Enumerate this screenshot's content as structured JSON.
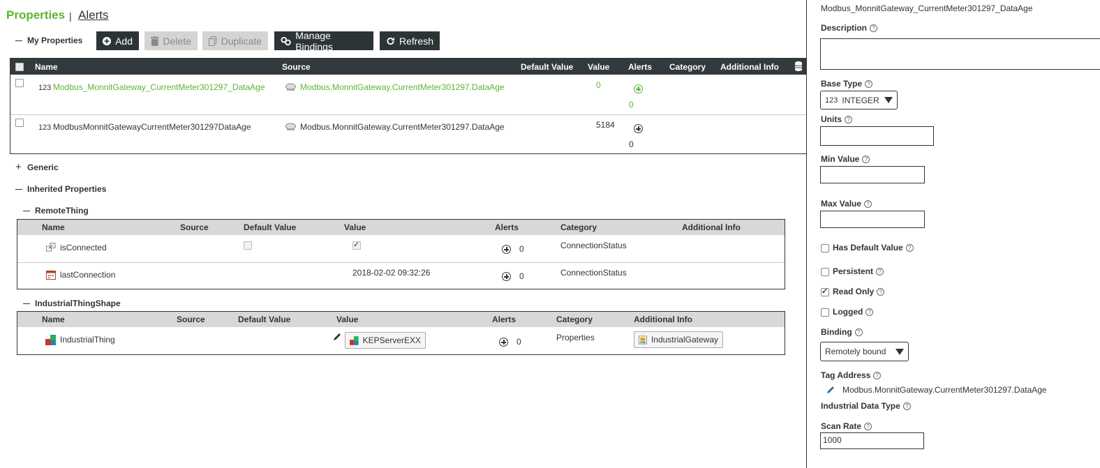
{
  "header": {
    "title": "Properties",
    "separator": "|",
    "alerts_link": "Alerts"
  },
  "my_properties": {
    "label": "My Properties",
    "toolbar": {
      "add": "Add",
      "delete": "Delete",
      "duplicate": "Duplicate",
      "manage_bindings": "Manage Bindings",
      "refresh": "Refresh"
    },
    "columns": [
      "Name",
      "Source",
      "Default Value",
      "Value",
      "Alerts",
      "Category",
      "Additional Info"
    ],
    "rows": [
      {
        "type_icon": "123",
        "name": "Modbus_MonnitGateway_CurrentMeter301297_DataAge",
        "source": "Modbus.MonnitGateway.CurrentMeter301297.DataAge",
        "value": "0",
        "alerts": "0"
      },
      {
        "type_icon": "123",
        "name": "ModbusMonnitGatewayCurrentMeter301297DataAge",
        "source": "Modbus.MonnitGateway.CurrentMeter301297.DataAge",
        "value": "5184",
        "alerts": "0"
      }
    ]
  },
  "generic": {
    "label": "Generic"
  },
  "inherited": {
    "label": "Inherited Properties",
    "remote_thing": {
      "label": "RemoteThing",
      "columns": [
        "Name",
        "Source",
        "Default Value",
        "Value",
        "Alerts",
        "Category",
        "Additional Info"
      ],
      "rows": [
        {
          "name": "isConnected",
          "value": "",
          "alerts": "0",
          "category": "ConnectionStatus"
        },
        {
          "name": "lastConnection",
          "value": "2018-02-02 09:32:26",
          "alerts": "0",
          "category": "ConnectionStatus"
        }
      ]
    },
    "industrial_shape": {
      "label": "IndustrialThingShape",
      "columns": [
        "Name",
        "Source",
        "Default Value",
        "Value",
        "Alerts",
        "Category",
        "Additional Info"
      ],
      "rows": [
        {
          "name": "IndustrialThing",
          "value": "KEPServerEXX",
          "alerts": "0",
          "category": "Properties",
          "additional_info": "IndustrialGateway"
        }
      ]
    }
  },
  "details": {
    "name": "Modbus_MonnitGateway_CurrentMeter301297_DataAge",
    "description_label": "Description",
    "description_value": "",
    "base_type_label": "Base Type",
    "base_type_icon": "123",
    "base_type_value": "INTEGER",
    "units_label": "Units",
    "units_value": "",
    "min_label": "Min Value",
    "min_value": "",
    "max_label": "Max Value",
    "max_value": "",
    "has_default_label": "Has Default Value",
    "persistent_label": "Persistent",
    "read_only_label": "Read Only",
    "logged_label": "Logged",
    "binding_label": "Binding",
    "binding_value": "Remotely bound",
    "tag_address_label": "Tag Address",
    "tag_address_value": "Modbus.MonnitGateway.CurrentMeter301297.DataAge",
    "industrial_type_label": "Industrial Data Type",
    "scan_rate_label": "Scan Rate",
    "scan_rate_value": "1000",
    "help_glyph": "?"
  },
  "colors": {
    "brand_green": "#5cb531",
    "toolbar_dark": "#2d3436",
    "header_dark": "#333a3d"
  }
}
